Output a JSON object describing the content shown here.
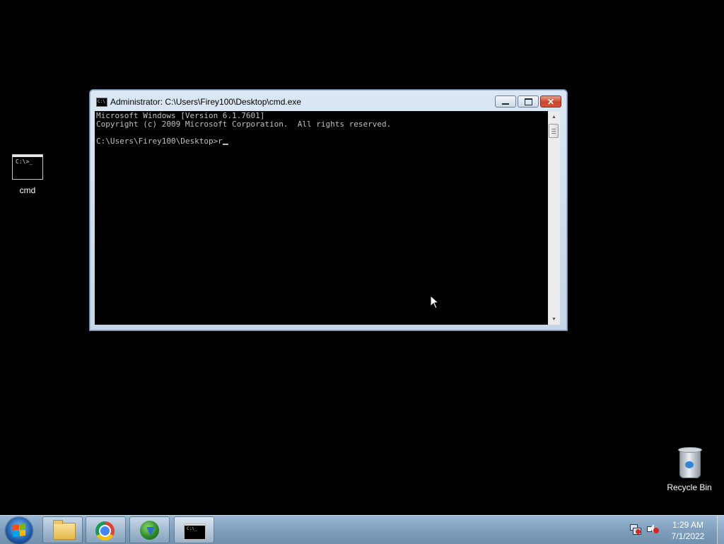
{
  "desktop": {
    "icons": [
      {
        "label": "cmd",
        "glyph": "C:\\>_"
      },
      {
        "label": "Recycle Bin"
      }
    ]
  },
  "window": {
    "title": "Administrator: C:\\Users\\Firey100\\Desktop\\cmd.exe",
    "icon_glyph": "C:\\",
    "console_lines": [
      "Microsoft Windows [Version 6.1.7601]",
      "Copyright (c) 2009 Microsoft Corporation.  All rights reserved.",
      "",
      "C:\\Users\\Firey100\\Desktop>r"
    ]
  },
  "taskbar": {
    "pinned": [
      "windows-explorer",
      "google-chrome",
      "internet-download-manager",
      "command-prompt"
    ],
    "term_glyph": "C:\\_",
    "clock": {
      "time": "1:29 AM",
      "date": "7/1/2022"
    }
  },
  "colors": {
    "desktop_bg": "#000000",
    "console_text": "#c0c0c0",
    "close_button": "#c9452b",
    "taskbar": "#7f9fbd"
  }
}
